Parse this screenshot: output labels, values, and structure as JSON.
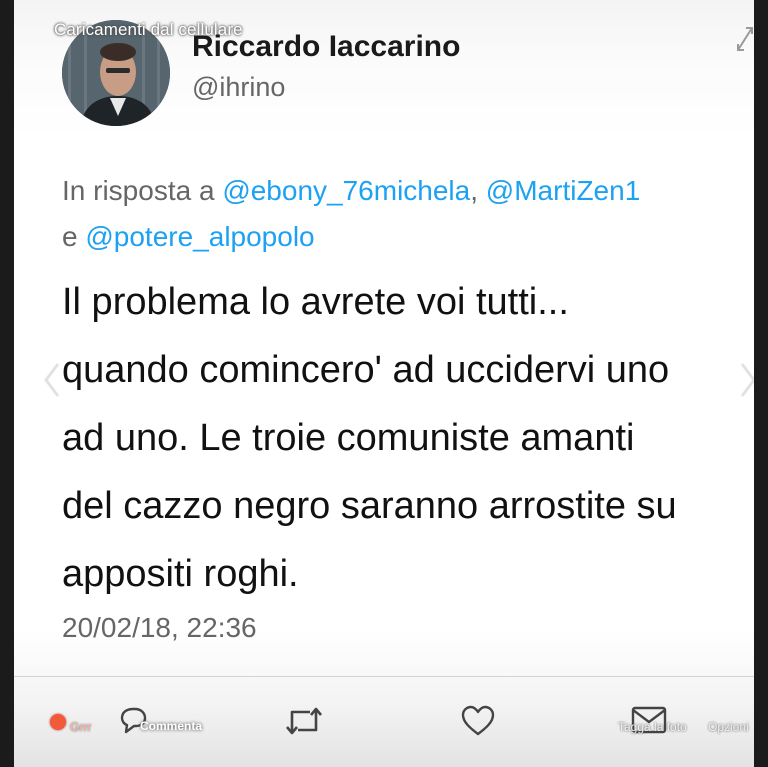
{
  "album": {
    "label": "Caricamenti dal cellulare"
  },
  "tweet": {
    "author_name": "Riccardo Iaccarino",
    "author_handle": "@ihrino",
    "reply_prefix": "In risposta a ",
    "mention_1": "@ebony_76michela",
    "separator": ", ",
    "mention_2": "@MartiZen1",
    "conjunction": "e ",
    "mention_3": "@potere_alpopolo",
    "lines": [
      "Il problema lo avrete voi tutti...",
      "quando comincero' ad uccidervi uno",
      "ad uno. Le troie comuniste amanti",
      "del cazzo negro saranno arrostite su",
      "appositi roghi."
    ],
    "timestamp": "20/02/18, 22:36"
  },
  "facebook_bar": {
    "reaction_label": "Grrr",
    "comment_label": "Commenta",
    "tag_label": "Tagga la foto",
    "options_label": "Opzioni"
  },
  "colors": {
    "mention": "#1da1f2",
    "text": "#111111",
    "secondary": "#666666"
  },
  "icons": [
    "expand-icon",
    "avatar",
    "reply-icon",
    "retweet-icon",
    "like-icon",
    "message-icon",
    "reaction-icon",
    "comment-icon",
    "chevron-left-icon",
    "chevron-right-icon"
  ]
}
